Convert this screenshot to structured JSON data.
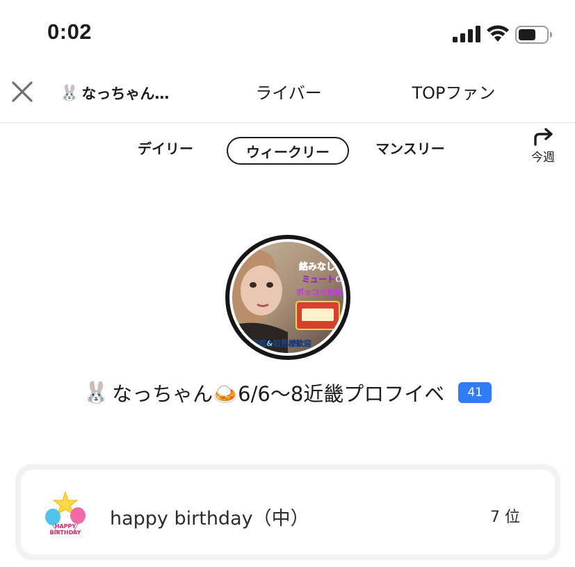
{
  "status_bar": {
    "time": "0:02",
    "icons": [
      "signal-icon",
      "wifi-icon",
      "battery-icon"
    ]
  },
  "header": {
    "tabs": [
      {
        "label": "なっちゃん…",
        "icon": "rabbit-icon",
        "active": true
      },
      {
        "label": "ライバー",
        "active": false
      },
      {
        "label": "TOPファン",
        "active": false
      }
    ]
  },
  "period": {
    "options": [
      "デイリー",
      "ウィークリー",
      "マンスリー"
    ],
    "selected": "ウィークリー",
    "this_week_label": "今週"
  },
  "streamer": {
    "name": "なっちゃん🍛6/6〜8近畿プロフイベ",
    "level": "41",
    "avatar_overlay_text": [
      "絡みなし",
      "ミュートO",
      "ボッコメ自由",
      "枠回収&初見様歓迎"
    ]
  },
  "ranking": {
    "gift_name": "happy birthday（中）",
    "rank": "7 位",
    "gift_icon_text": [
      "HAPPY",
      "BIRTHDAY"
    ]
  },
  "colors": {
    "accent_blue": "#2f7cf6",
    "text_primary": "#1c1c1e",
    "divider": "#e5e5ea"
  }
}
